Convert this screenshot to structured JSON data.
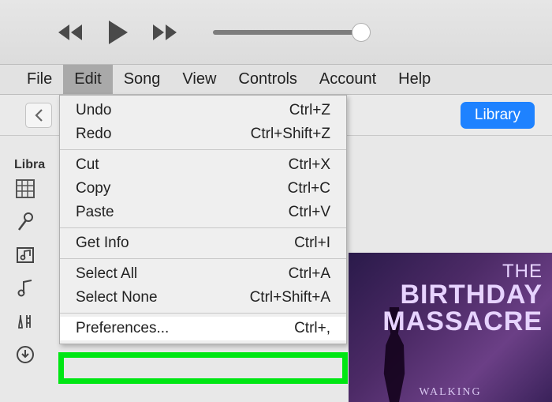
{
  "menubar": {
    "items": [
      "File",
      "Edit",
      "Song",
      "View",
      "Controls",
      "Account",
      "Help"
    ],
    "active_index": 1
  },
  "toolbar": {
    "library_button": "Library"
  },
  "library_label": "Libra",
  "dropdown": {
    "groups": [
      [
        {
          "label": "Undo",
          "shortcut": "Ctrl+Z"
        },
        {
          "label": "Redo",
          "shortcut": "Ctrl+Shift+Z"
        }
      ],
      [
        {
          "label": "Cut",
          "shortcut": "Ctrl+X"
        },
        {
          "label": "Copy",
          "shortcut": "Ctrl+C"
        },
        {
          "label": "Paste",
          "shortcut": "Ctrl+V"
        }
      ],
      [
        {
          "label": "Get Info",
          "shortcut": "Ctrl+I"
        }
      ],
      [
        {
          "label": "Select All",
          "shortcut": "Ctrl+A"
        },
        {
          "label": "Select None",
          "shortcut": "Ctrl+Shift+A"
        }
      ],
      [
        {
          "label": "Preferences...",
          "shortcut": "Ctrl+,",
          "highlight": true
        }
      ]
    ]
  },
  "album": {
    "line1": "THE",
    "line2": "BIRTHDAY",
    "line3": "MASSACRE",
    "sub": "WALKING"
  }
}
